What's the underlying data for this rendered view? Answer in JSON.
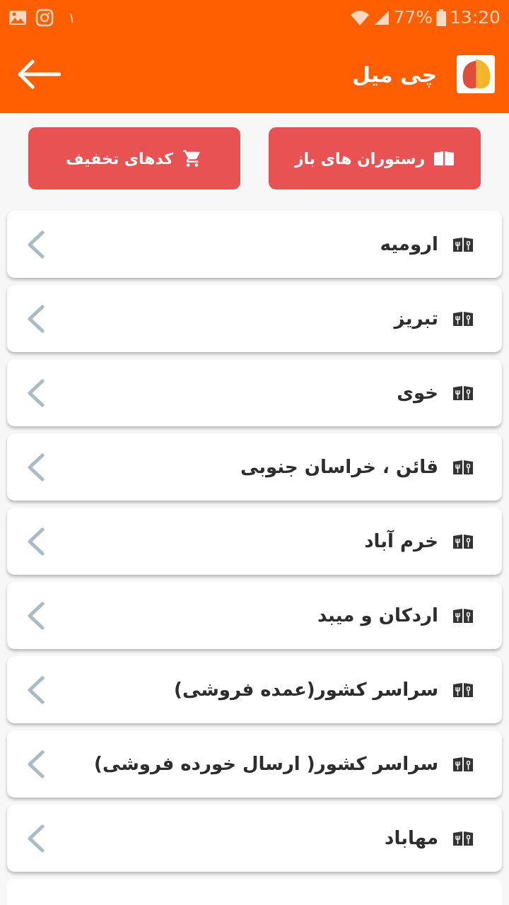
{
  "status_bar": {
    "notification_count": "١",
    "battery": "77%",
    "time": "13:20"
  },
  "app_bar": {
    "title": "چی میل"
  },
  "actions": [
    {
      "label": "رستوران های باز",
      "kind": "menu"
    },
    {
      "label": "کدهای تخفیف",
      "kind": "cart"
    }
  ],
  "cities": [
    {
      "name": "ارومیه"
    },
    {
      "name": "تبریز"
    },
    {
      "name": "خوی"
    },
    {
      "name": "قائن ، خراسان جنوبی"
    },
    {
      "name": "خرم آباد"
    },
    {
      "name": "اردکان و میبد"
    },
    {
      "name": "سراسر کشور(عمده فروشی)"
    },
    {
      "name": "سراسر کشور( ارسال خورده فروشی)"
    },
    {
      "name": "مهاباد"
    }
  ]
}
